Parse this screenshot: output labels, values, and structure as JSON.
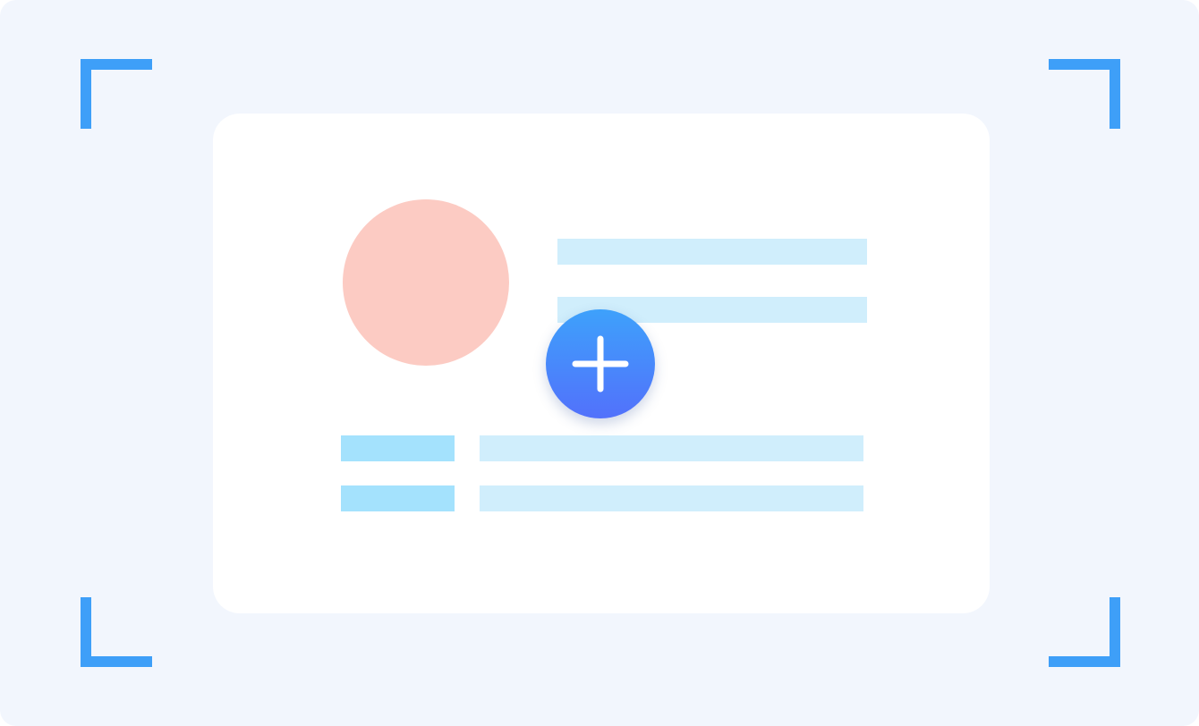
{
  "illustration": {
    "accent_color": "#3e9ff8",
    "background_color": "#f2f6fd",
    "card_color": "#ffffff",
    "avatar_color": "#fccbc3",
    "placeholder_light_color": "#d0eefc",
    "placeholder_dark_color": "#a4e2fd",
    "button_gradient": [
      "#3ea1fb",
      "#5271fb"
    ],
    "icons": {
      "add": "plus-icon",
      "frame_corners": "scan-frame-corner-icon"
    }
  }
}
